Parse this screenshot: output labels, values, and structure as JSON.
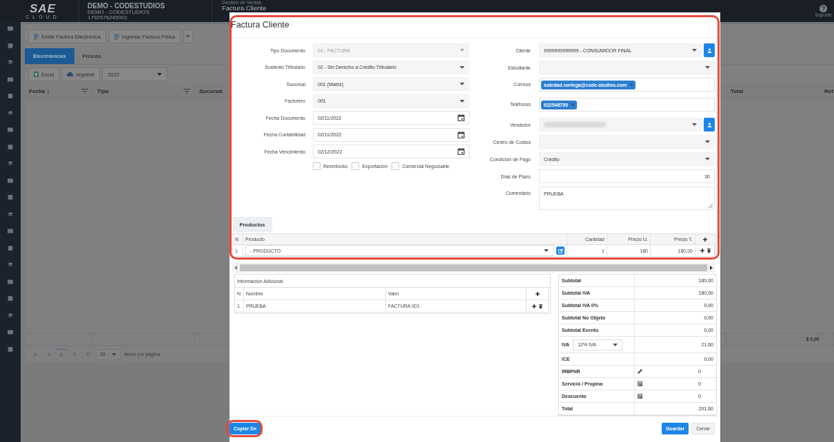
{
  "topbar": {
    "logo": "SAE",
    "logo_sub": "CLOUD",
    "company": "DEMO - CODESTUDIOS",
    "company_sub": "DEMO - CODESTUDIOS",
    "ruc": "1792576245002",
    "breadcrumb": "Gestión de Ventas",
    "page_title": "Factura Cliente",
    "support": "Soporte"
  },
  "toolbar": {
    "buttons": [
      "Emitir Factura Electrónica",
      "Ingresar Factura Física"
    ]
  },
  "tabs": [
    {
      "label": "Electrónicas",
      "selected": true
    },
    {
      "label": "Físicas",
      "selected": false
    }
  ],
  "actions": {
    "excel": "Excel",
    "print": "Imprimir",
    "year": "2022"
  },
  "table": {
    "columns": [
      "Fecha",
      "Tipo",
      "Sucursal"
    ],
    "right_columns": [
      "Total",
      "Ret"
    ],
    "footer_total": "$ 0,00"
  },
  "pager": {
    "page": "0",
    "page_size": "25",
    "label": "ítems por página"
  },
  "dialog": {
    "title": "Factura Cliente",
    "left_fields": [
      {
        "label": "Tipo Documento",
        "kind": "select",
        "value": "01 - FACTURA",
        "disabled": true
      },
      {
        "label": "Sustento Tributario",
        "kind": "select",
        "value": "02 - Sin Derecho a Crédito Tributario",
        "disabled": false
      },
      {
        "label": "Sucursal",
        "kind": "select",
        "value": "001 (Matriz)",
        "disabled": false
      },
      {
        "label": "Facturero",
        "kind": "select",
        "value": "001",
        "disabled": false
      },
      {
        "label": "Fecha Documento",
        "kind": "date",
        "value": "02/11/2022",
        "disabled": false
      },
      {
        "label": "Fecha Contabilidad",
        "kind": "date",
        "value": "02/11/2022",
        "disabled": false
      },
      {
        "label": "Fecha Vencimiento",
        "kind": "date",
        "value": "02/12/2022",
        "disabled": false
      }
    ],
    "checkboxes": [
      {
        "label": "Reembolso",
        "checked": false
      },
      {
        "label": "Exportación",
        "checked": false
      },
      {
        "label": "Comercial Negociable",
        "checked": false
      }
    ],
    "right_fields": [
      {
        "label": "Cliente",
        "kind": "select",
        "value": "9999999999999 - CONSUMIDOR FINAL",
        "action_button": true
      },
      {
        "label": "Estudiante",
        "kind": "select",
        "action_button": false
      },
      {
        "label": "Correos",
        "kind": "tags",
        "tags": [
          "soledad.noriega@code-studios.com"
        ],
        "action_button": false
      },
      {
        "label": "Teléfonos",
        "kind": "tags",
        "tags": [
          "022548750"
        ],
        "action_button": false
      },
      {
        "label": "Vendedor",
        "kind": "redacted",
        "action_button": true
      },
      {
        "label": "Centro de Costos",
        "kind": "select",
        "action_button": false
      },
      {
        "label": "Condición de Pago",
        "kind": "select",
        "value": "Crédito",
        "action_button": false
      },
      {
        "label": "Días de Plazo",
        "kind": "number",
        "value": "30",
        "action_button": false
      },
      {
        "label": "Comentario",
        "kind": "textarea",
        "value": "PRUEBA",
        "action_button": false
      }
    ],
    "products": {
      "tab": "Productos",
      "columns": [
        "N",
        "Producto",
        "Cantidad",
        "Precio U.",
        "Precio T."
      ],
      "rows": [
        {
          "n": "1",
          "product": "- PRODUCTO",
          "qty": "1",
          "price": "180",
          "total": "180,00"
        }
      ]
    },
    "info": {
      "title": "Información Adicional",
      "columns": [
        "N",
        "Nombre",
        "Valor"
      ],
      "rows": [
        {
          "n": "1",
          "name": "PRUEBA",
          "value": "FACTURA 001"
        }
      ]
    },
    "totals": [
      {
        "label": "Subtotal",
        "kind": "plain",
        "value": "180,00"
      },
      {
        "label": "Subtotal IVA",
        "kind": "plain",
        "value": "180,00"
      },
      {
        "label": "Subtotal IVA 0%",
        "kind": "plain",
        "value": "0,00"
      },
      {
        "label": "Subtotal No Objeto",
        "kind": "plain",
        "value": "0,00"
      },
      {
        "label": "Subtotal Exento",
        "kind": "plain",
        "value": "0,00"
      },
      {
        "label": "IVA",
        "kind": "select",
        "select": "12% IVA",
        "value": "21,60"
      },
      {
        "label": "ICE",
        "kind": "plain",
        "value": "0,00"
      },
      {
        "label": "IRBPNR",
        "kind": "edit",
        "value": "0"
      },
      {
        "label": "Servicio / Propina",
        "kind": "calc",
        "value": "0"
      },
      {
        "label": "Descuento",
        "kind": "calc",
        "value": "0"
      },
      {
        "label": "Total",
        "kind": "plain",
        "value": "201,60"
      }
    ],
    "buttons": {
      "copy": "Copiar De",
      "save": "Guardar",
      "close": "Cerrar"
    }
  }
}
